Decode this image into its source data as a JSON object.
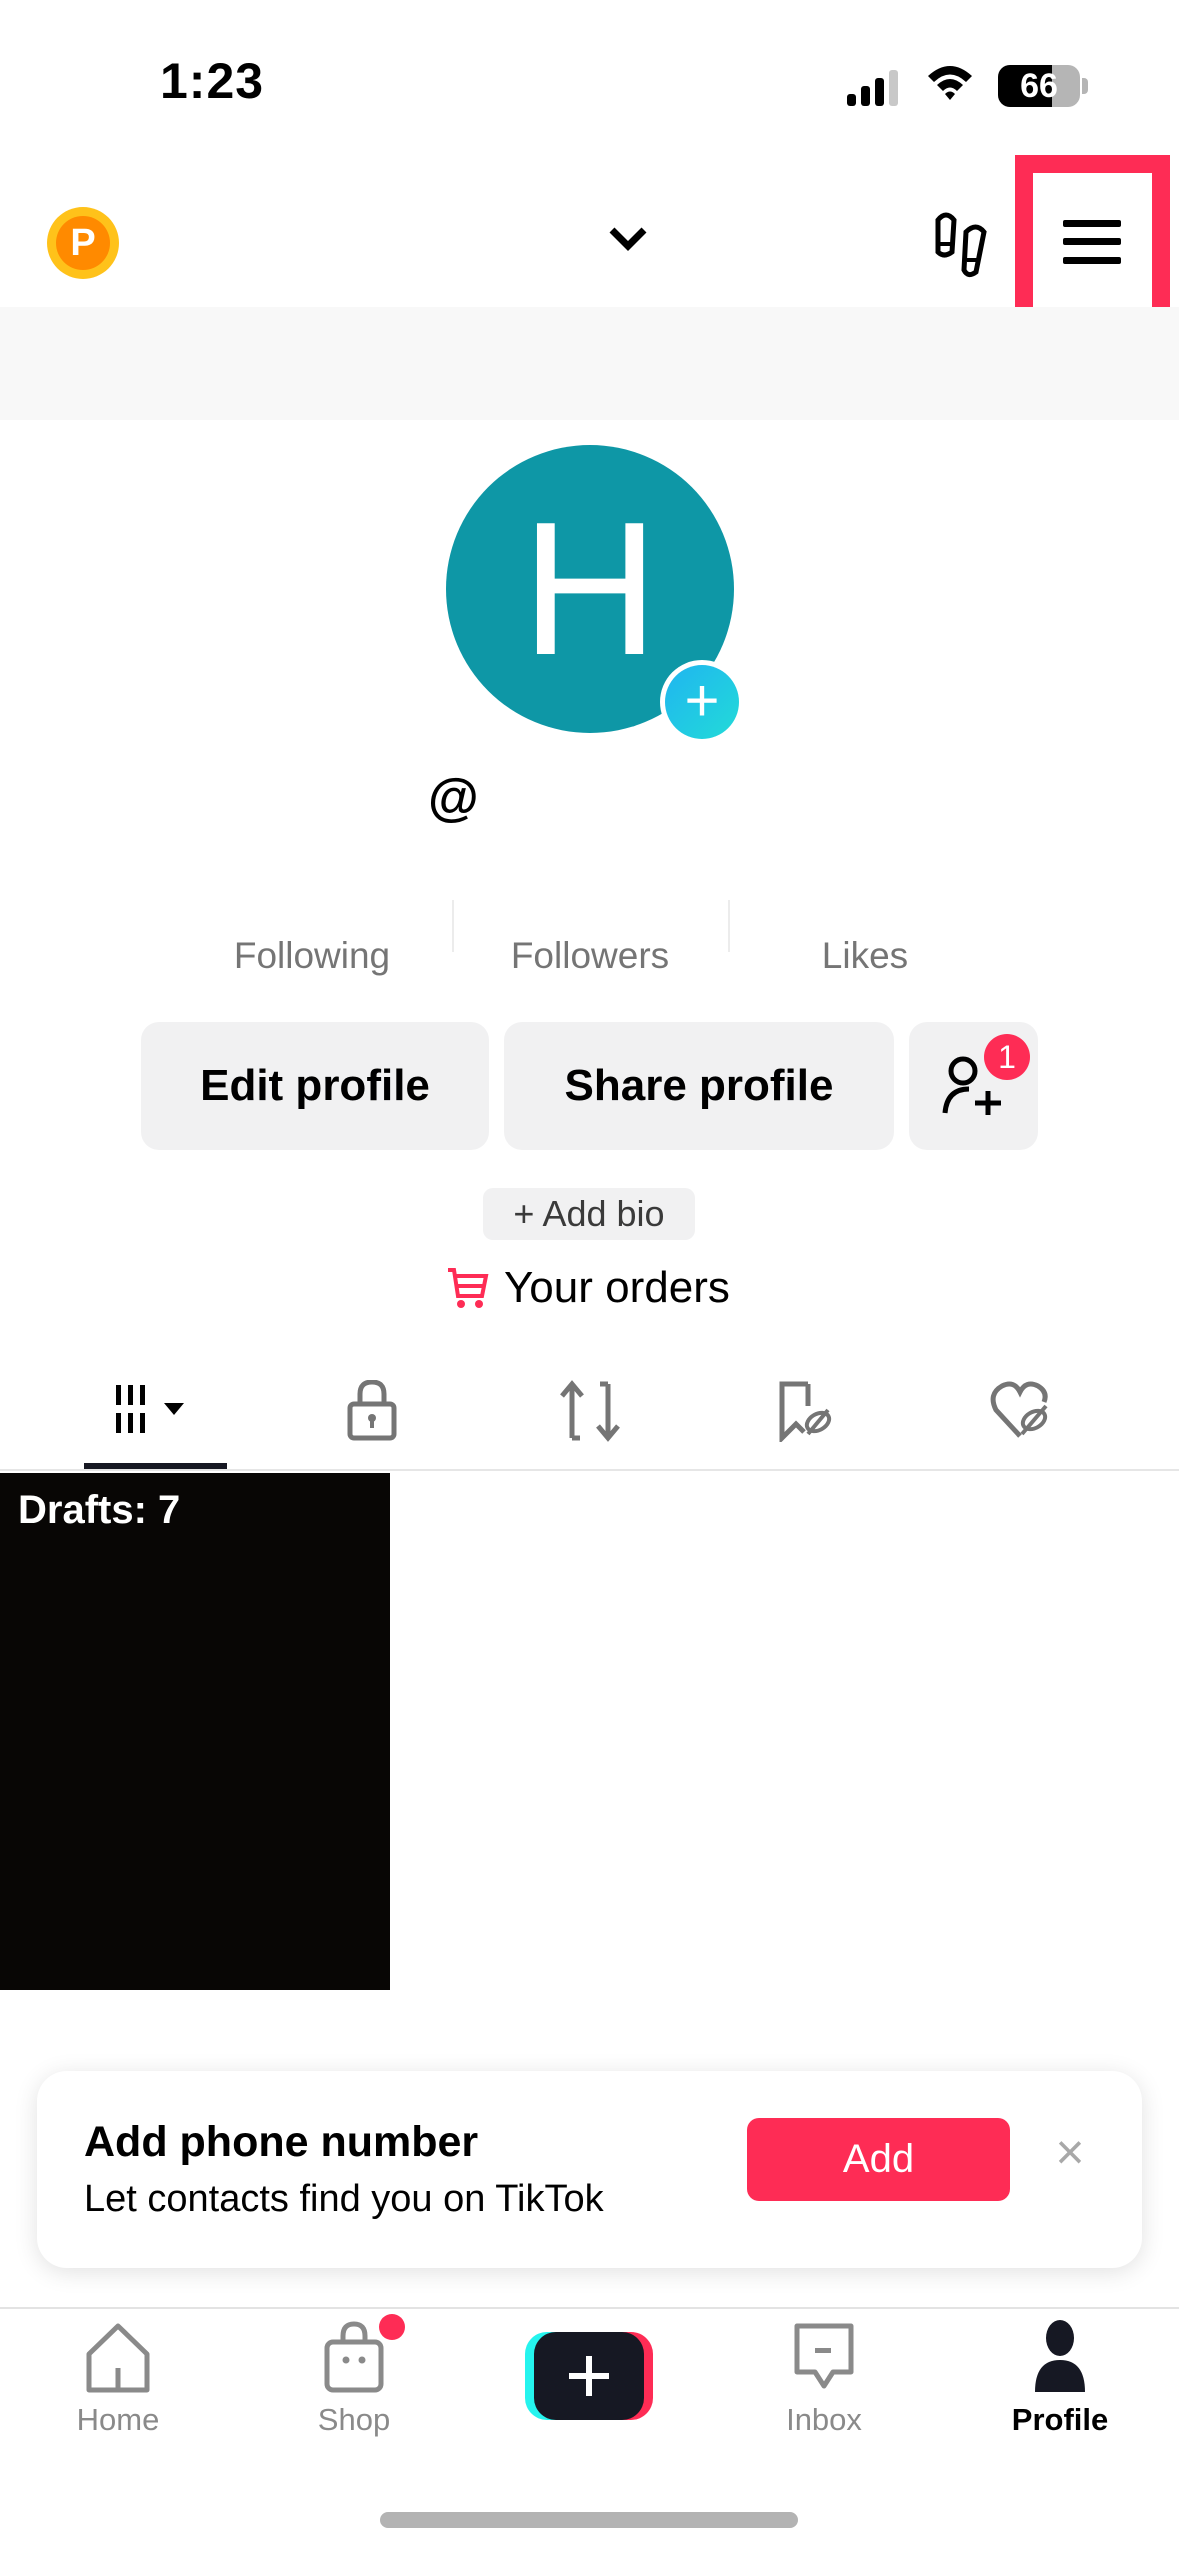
{
  "status_bar": {
    "time": "1:23",
    "battery_percent": "66",
    "battery_level": 0.66,
    "icons": [
      "cellular-signal-icon",
      "wifi-icon",
      "battery-icon"
    ]
  },
  "header": {
    "coin_label": "P",
    "username": "",
    "icons": [
      "coin-icon",
      "chevron-down-icon",
      "footprints-icon",
      "menu-icon"
    ],
    "highlight_color": "#fe2c55"
  },
  "profile": {
    "avatar_initial": "H",
    "avatar_color": "#0e97a6",
    "handle": "@",
    "stats": [
      {
        "label": "Following",
        "value": ""
      },
      {
        "label": "Followers",
        "value": ""
      },
      {
        "label": "Likes",
        "value": ""
      }
    ],
    "buttons": {
      "edit": "Edit profile",
      "share": "Share profile",
      "add_friends_badge": "1"
    },
    "add_bio": "+ Add bio",
    "orders": "Your orders"
  },
  "tabs": [
    {
      "name": "videos",
      "icon": "grid-icon",
      "active": true
    },
    {
      "name": "private",
      "icon": "lock-icon",
      "active": false
    },
    {
      "name": "reposts",
      "icon": "repost-icon",
      "active": false
    },
    {
      "name": "favorites",
      "icon": "bookmark-hidden-icon",
      "active": false
    },
    {
      "name": "liked",
      "icon": "heart-hidden-icon",
      "active": false
    }
  ],
  "drafts": {
    "label": "Drafts: 7"
  },
  "phone_card": {
    "title": "Add phone number",
    "subtitle": "Let contacts find you on TikTok",
    "add_label": "Add",
    "close_glyph": "×",
    "accent": "#fe2c55"
  },
  "nav": {
    "items": [
      {
        "label": "Home",
        "icon": "home-icon",
        "active": false
      },
      {
        "label": "Shop",
        "icon": "shop-bag-icon",
        "active": false,
        "dot": true
      },
      {
        "label": "",
        "icon": "create-plus-icon",
        "active": false
      },
      {
        "label": "Inbox",
        "icon": "inbox-icon",
        "active": false
      },
      {
        "label": "Profile",
        "icon": "profile-icon",
        "active": true
      }
    ]
  }
}
